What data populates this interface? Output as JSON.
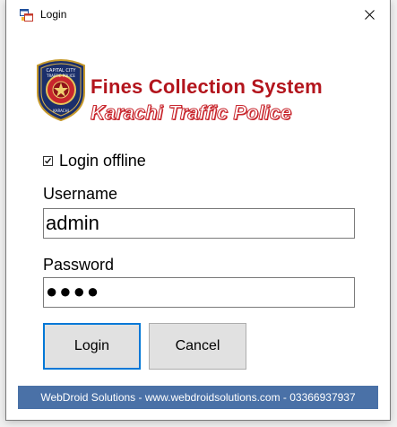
{
  "window": {
    "title": "Login",
    "close_glyph": "✕"
  },
  "branding": {
    "title": "Fines Collection System",
    "subtitle": "Karachi Traffic Police",
    "logo_icon": "traffic-police-badge-icon",
    "logo_text_top": "CAPITAL CITY",
    "logo_text_mid": "TRAFFIC POLICE",
    "logo_text_bottom": "KARACHI"
  },
  "form": {
    "offline_checkbox": {
      "label": "Login offline",
      "checked": true,
      "glyph": "☑"
    },
    "username": {
      "label": "Username",
      "value": "admin"
    },
    "password": {
      "label": "Password",
      "masked_value": "●●●●"
    }
  },
  "buttons": {
    "login": "Login",
    "cancel": "Cancel"
  },
  "footer": {
    "text": "WebDroid Solutions - www.webdroidsolutions.com - 03366937937"
  },
  "colors": {
    "brand_red": "#b3151d",
    "footer_blue": "#4a71a7",
    "focus_blue": "#0078d7"
  }
}
